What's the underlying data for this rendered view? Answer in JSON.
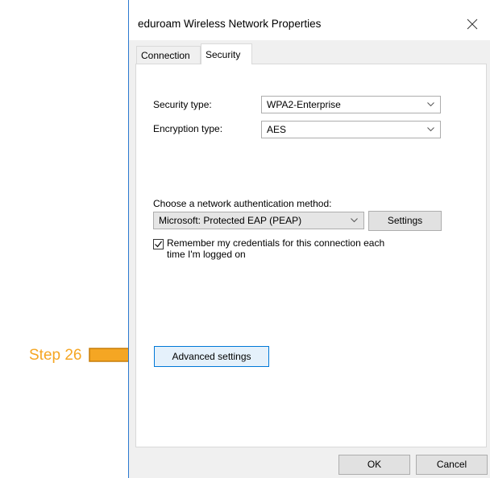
{
  "window": {
    "title": "eduroam Wireless Network Properties",
    "close_icon": "close-icon"
  },
  "tabs": [
    {
      "label": "Connection",
      "active": false
    },
    {
      "label": "Security",
      "active": true
    }
  ],
  "security": {
    "security_type_label": "Security type:",
    "security_type_value": "WPA2-Enterprise",
    "encryption_type_label": "Encryption type:",
    "encryption_type_value": "AES",
    "auth_method_label": "Choose a network authentication method:",
    "auth_method_value": "Microsoft: Protected EAP (PEAP)",
    "settings_button": "Settings",
    "remember_checkbox_line1": "Remember my credentials for this connection each",
    "remember_checkbox_line2": "time I'm logged on",
    "remember_checked": true,
    "advanced_settings_button": "Advanced settings"
  },
  "footer": {
    "ok_button": "OK",
    "cancel_button": "Cancel"
  },
  "annotation": {
    "step_label": "Step 26",
    "arrow_icon": "right-arrow-icon",
    "color": "#f5a623"
  }
}
